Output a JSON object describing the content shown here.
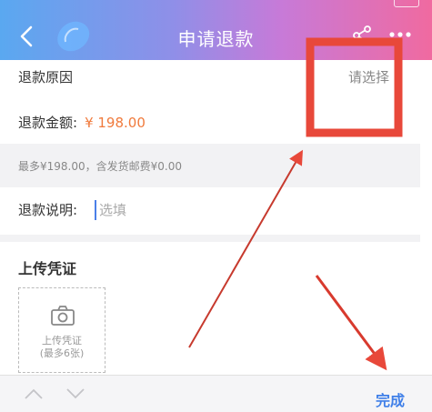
{
  "header": {
    "title": "申请退款"
  },
  "reason": {
    "label": "退款原因",
    "select_label": "请选择"
  },
  "amount": {
    "label": "退款金额:",
    "value": "¥ 198.00"
  },
  "note": {
    "text": "最多¥198.00，含发货邮费¥0.00"
  },
  "description": {
    "label": "退款说明:",
    "placeholder": "选填"
  },
  "upload": {
    "title": "上传凭证",
    "box_line1": "上传凭证",
    "box_line2": "(最多6张)"
  },
  "toolbar": {
    "done_label": "完成"
  },
  "colors": {
    "accent": "#3f7fe8",
    "price": "#f07a3c",
    "annotation": "#e8483a"
  }
}
